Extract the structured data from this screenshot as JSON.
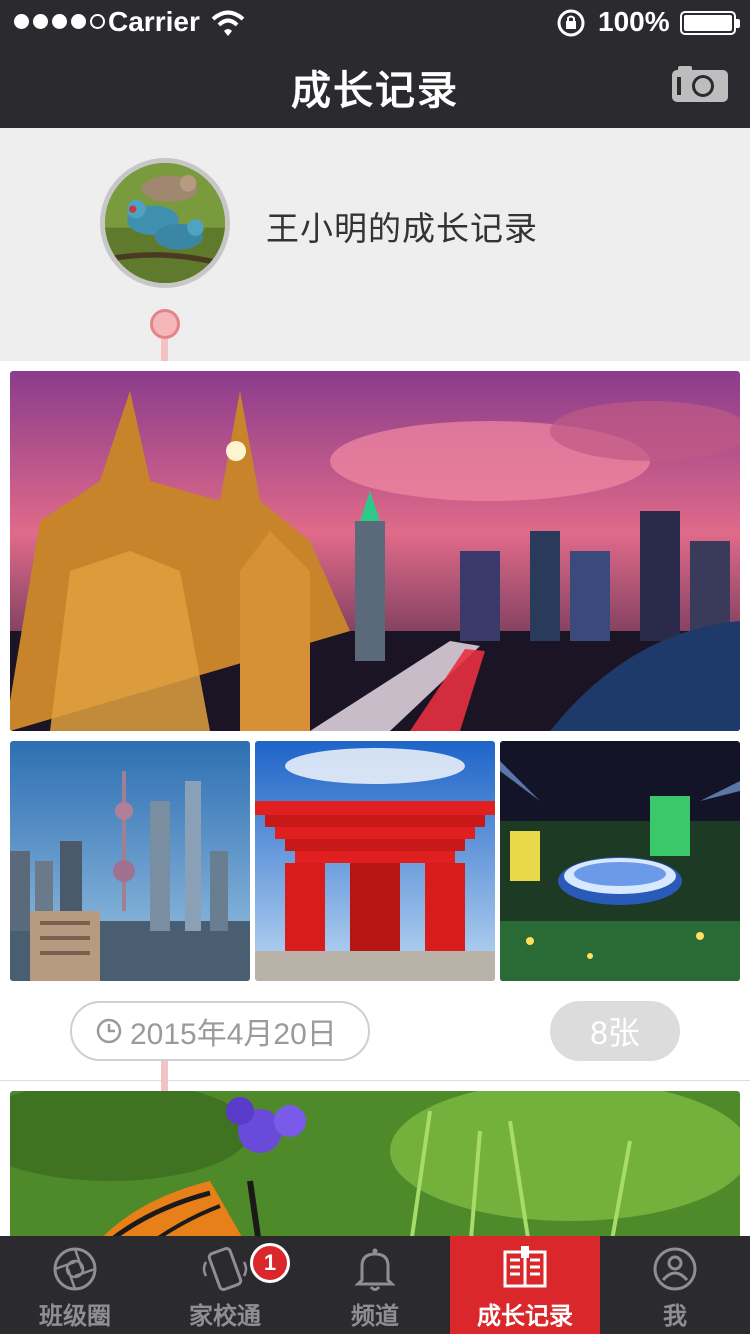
{
  "status_bar": {
    "carrier": "Carrier",
    "battery": "100%",
    "signal_bars": 4
  },
  "nav": {
    "title": "成长记录",
    "camera_icon": "camera-icon"
  },
  "profile": {
    "name": "王小明的成长记录",
    "avatar_icon": "birds-avatar"
  },
  "entries": [
    {
      "date": "2015年4月20日",
      "count": "8张",
      "photos": [
        "shanghai-bund-night",
        "lujiazui-skyline",
        "china-pavilion",
        "stadium-night"
      ]
    },
    {
      "photos": [
        "butterfly-flowers"
      ]
    }
  ],
  "tabbar": {
    "items": [
      {
        "label": "班级圈",
        "icon": "aperture-icon"
      },
      {
        "label": "家校通",
        "icon": "phone-icon",
        "badge": "1"
      },
      {
        "label": "频道",
        "icon": "bell-icon"
      },
      {
        "label": "成长记录",
        "icon": "book-icon",
        "active": true
      },
      {
        "label": "我",
        "icon": "user-icon"
      }
    ]
  },
  "colors": {
    "bar_bg": "#2b2b2f",
    "accent": "#d9272b",
    "timeline": "#f2c2c4"
  }
}
